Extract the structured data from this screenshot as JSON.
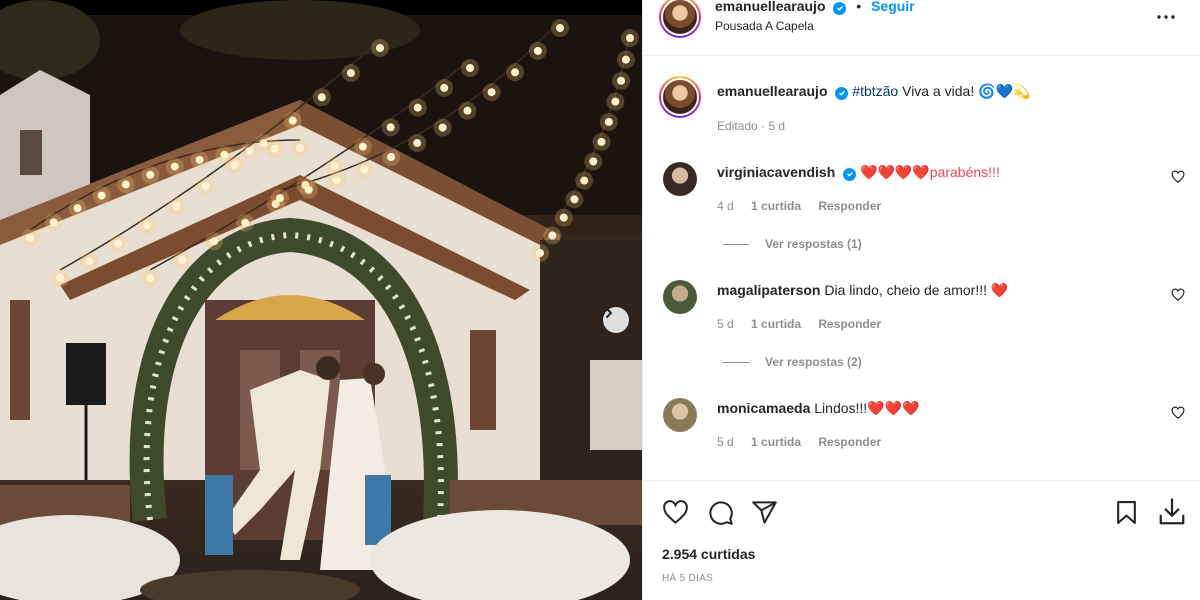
{
  "post": {
    "author": "emanuellearaujo",
    "follow_label": "Seguir",
    "separator": "•",
    "location": "Pousada A Capela"
  },
  "caption": {
    "username": "emanuellearaujo",
    "hashtag": "#tbtzão",
    "text": " Viva a vida! 🌀💙💫",
    "meta": "Editado · 5 d"
  },
  "comments": [
    {
      "username": "virginiacavendish",
      "verified": true,
      "text": "❤️❤️❤️❤️parabéns!!!",
      "age": "4 d",
      "likes": "1 curtida",
      "reply_label": "Responder",
      "view_replies": "Ver respostas (1)"
    },
    {
      "username": "magalipaterson",
      "verified": false,
      "text": "Dia lindo, cheio de amor!!! ❤️",
      "age": "5 d",
      "likes": "1 curtida",
      "reply_label": "Responder",
      "view_replies": "Ver respostas (2)"
    },
    {
      "username": "monicamaeda",
      "verified": false,
      "text": "Lindos!!!❤️❤️❤️",
      "age": "5 d",
      "likes": "1 curtida",
      "reply_label": "Responder"
    }
  ],
  "footer": {
    "likes": "2.954 curtidas",
    "date": "HÁ 5 DIAS"
  },
  "icons": {
    "like": "heart-outline-icon",
    "comment": "comment-bubble-icon",
    "share": "paper-plane-icon",
    "save": "bookmark-icon",
    "download": "download-icon",
    "more": "more-horizontal-icon",
    "next": "chevron-right-icon"
  },
  "colors": {
    "link_blue": "#0095f6",
    "hashtag": "#00376b",
    "muted": "#8e8e8e",
    "heart_red": "#ed4956",
    "border": "#efefef"
  }
}
